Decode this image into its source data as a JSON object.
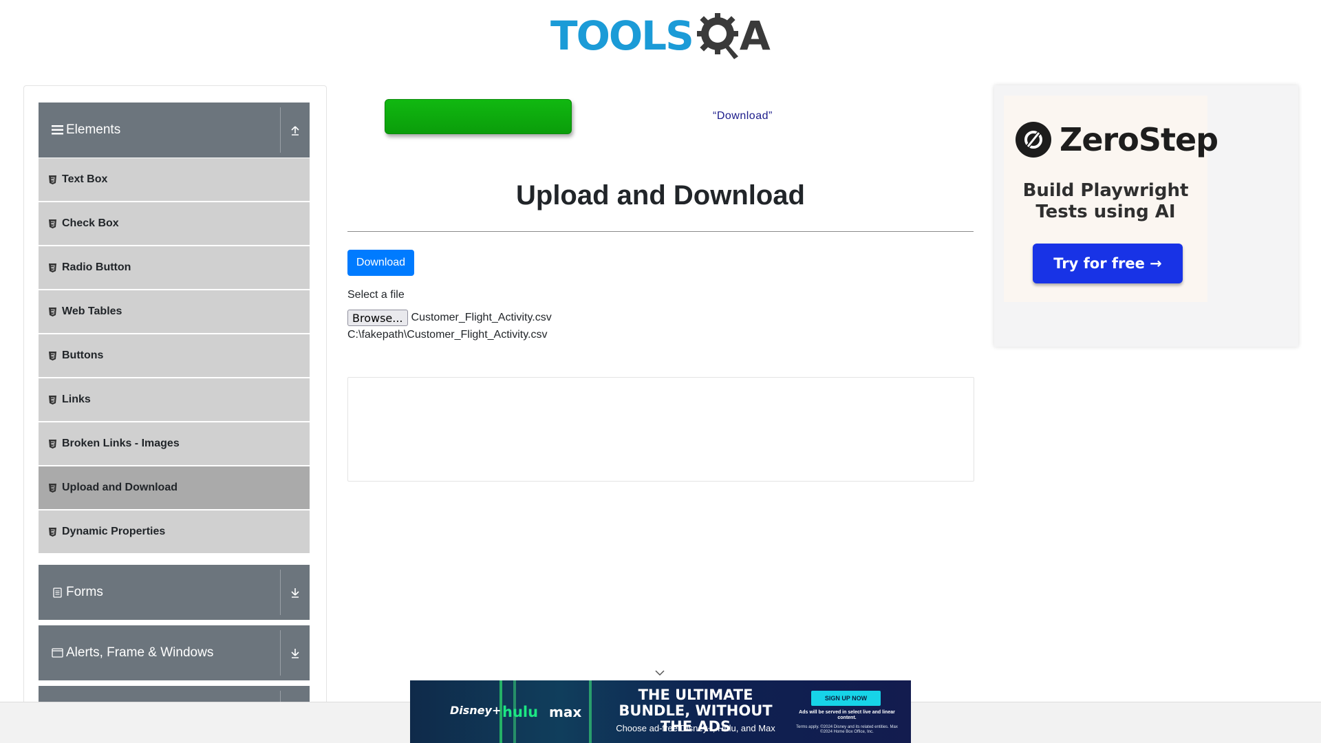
{
  "header": {
    "logo_text_tools": "TOOLS",
    "logo_text_a": "A"
  },
  "sidebar": {
    "groups": [
      {
        "label": "Elements",
        "icon": "hamburger-icon",
        "toggle_icon": "arrow-up-icon",
        "expanded": true
      },
      {
        "label": "Forms",
        "icon": "form-icon",
        "toggle_icon": "arrow-down-icon",
        "expanded": false
      },
      {
        "label": "Alerts, Frame & Windows",
        "icon": "window-icon",
        "toggle_icon": "arrow-down-icon",
        "expanded": false
      }
    ],
    "items": [
      {
        "label": "Text Box",
        "active": false
      },
      {
        "label": "Check Box",
        "active": false
      },
      {
        "label": "Radio Button",
        "active": false
      },
      {
        "label": "Web Tables",
        "active": false
      },
      {
        "label": "Buttons",
        "active": false
      },
      {
        "label": "Links",
        "active": false
      },
      {
        "label": "Broken Links - Images",
        "active": false
      },
      {
        "label": "Upload and Download",
        "active": true
      },
      {
        "label": "Dynamic Properties",
        "active": false
      }
    ]
  },
  "top_banner": {
    "quote_text": "“Download”"
  },
  "main": {
    "title": "Upload and Download",
    "download_button": "Download",
    "select_label": "Select a file",
    "browse_button": "Browse...",
    "selected_file": "Customer_Flight_Activity.csv",
    "uploaded_path": "C:\\fakepath\\Customer_Flight_Activity.csv"
  },
  "right_ad": {
    "brand": "ZeroStep",
    "tagline": "Build Playwright Tests using AI",
    "cta": "Try for free →"
  },
  "bottom_ad": {
    "brand1": "Disney+",
    "brand2": "hulu",
    "brand3": "max",
    "headline": "THE ULTIMATE BUNDLE, WITHOUT THE ADS",
    "sub": "Choose ad-free Disney+, Hulu, and Max",
    "cta": "SIGN UP NOW",
    "fine1": "Ads will be served in select live and linear content.",
    "fine2": "Terms apply. ©2024 Disney and its related entities. Max ©2024 Home Box Office, Inc."
  },
  "colors": {
    "accent_blue": "#007bff",
    "sidebar_header": "#6c757d",
    "sidebar_item": "#d0d0d0",
    "sidebar_item_active": "#aaaaaa",
    "logo_blue": "#1b9bd7"
  }
}
